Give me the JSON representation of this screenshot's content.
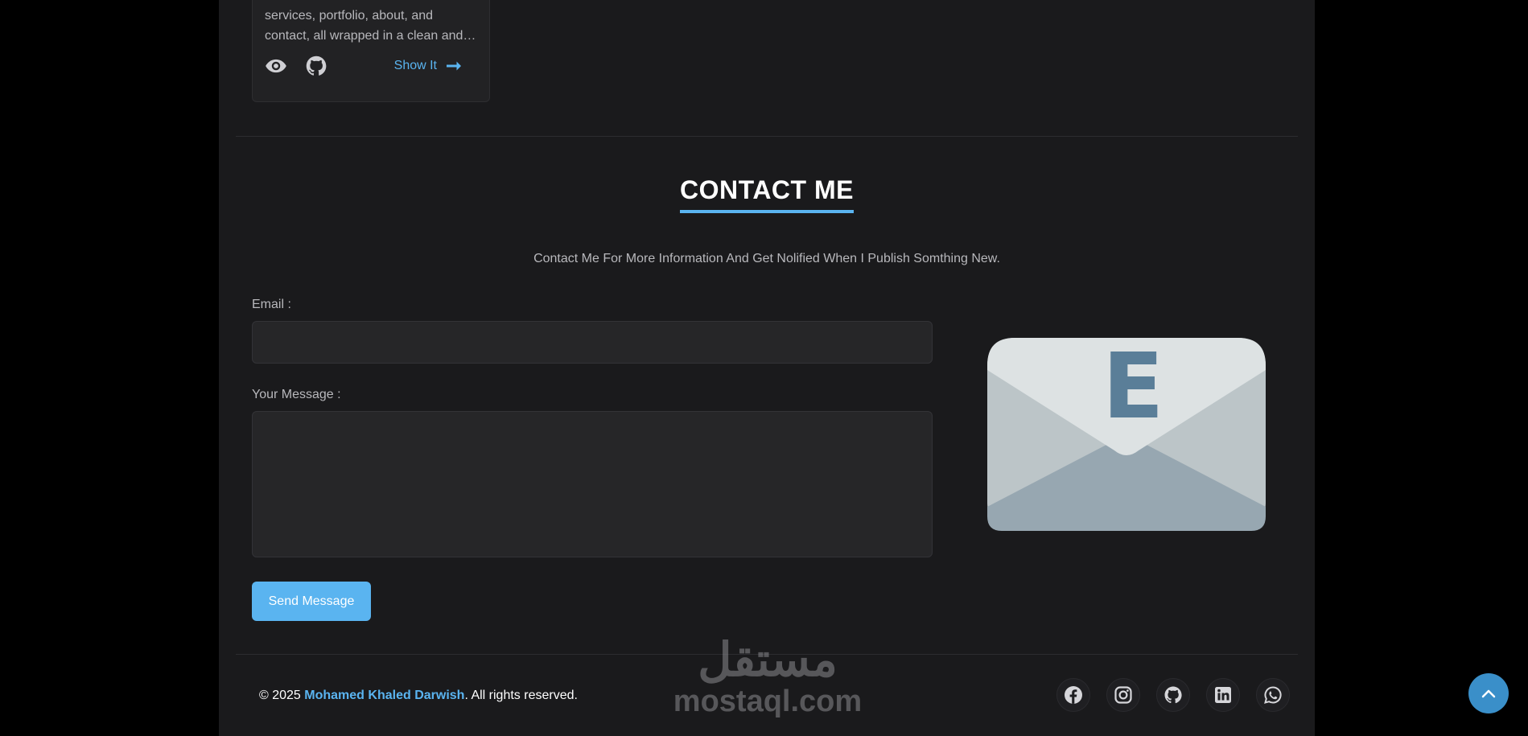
{
  "project_card": {
    "description": "services, portfolio, about, and contact, all wrapped in a clean and…",
    "show_label": "Show It",
    "icons": {
      "preview": "eye-icon",
      "repo": "github-icon",
      "arrow": "arrow-right-icon"
    }
  },
  "contact": {
    "title": "CONTACT ME",
    "subtitle": "Contact Me For More Information And Get Nolified When I Publish Somthing New.",
    "email_label": "Email :",
    "email_value": "",
    "email_placeholder": "",
    "message_label": "Your Message :",
    "message_value": "",
    "message_placeholder": "",
    "send_label": "Send Message",
    "illustration": {
      "icon": "envelope-icon",
      "letter": "E"
    }
  },
  "footer": {
    "copyright_prefix": "© 2025 ",
    "author": "Mohamed Khaled Darwish",
    "copyright_suffix": ". All rights reserved.",
    "social": [
      {
        "name": "facebook-icon"
      },
      {
        "name": "instagram-icon"
      },
      {
        "name": "github-icon"
      },
      {
        "name": "linkedin-icon"
      },
      {
        "name": "whatsapp-icon"
      }
    ]
  },
  "watermark": {
    "arabic": "مستقل",
    "latin": "mostaql.com"
  },
  "scroll_top": {
    "icon": "chevron-up-icon"
  },
  "colors": {
    "accent": "#5ab4f0",
    "background": "#1a1a1c",
    "outer_background": "#000000",
    "text_muted": "#b8b8bc",
    "field_background": "#262628"
  }
}
